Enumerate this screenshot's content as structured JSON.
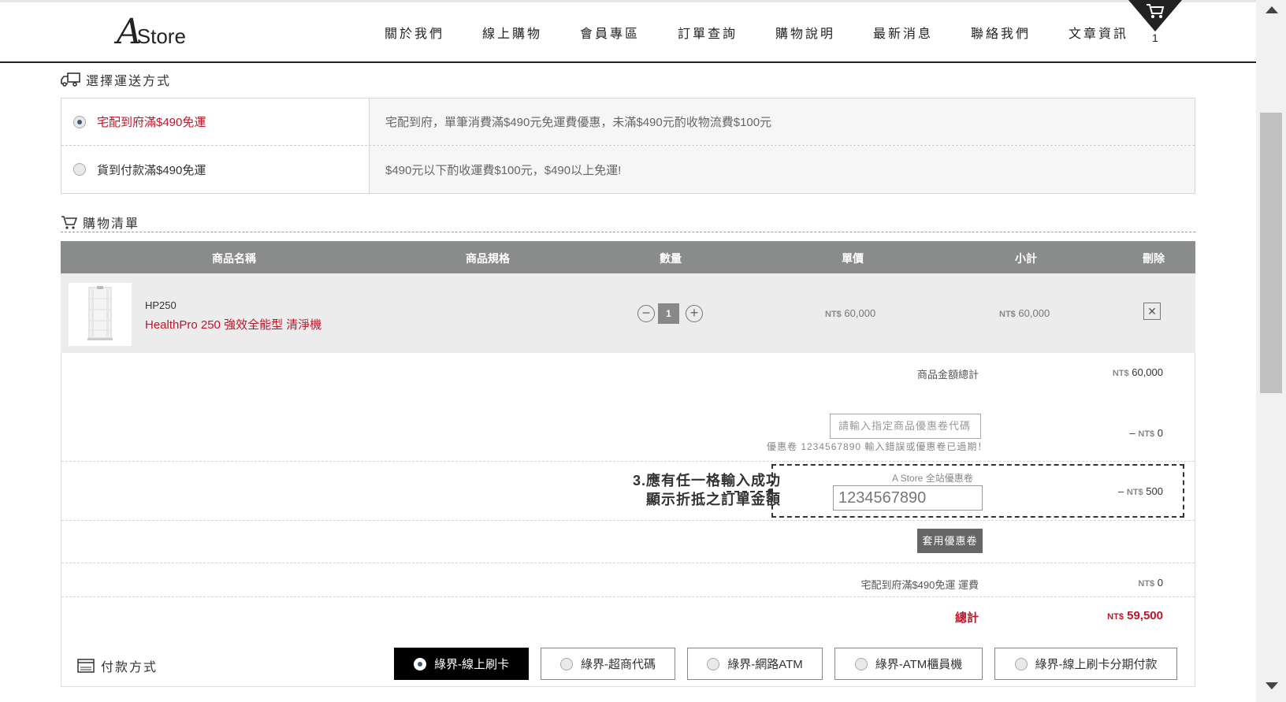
{
  "header": {
    "logo_a": "A",
    "logo_store": "Store",
    "nav": [
      "關於我們",
      "線上購物",
      "會員專區",
      "訂單查詢",
      "購物說明",
      "最新消息",
      "聯絡我們",
      "文章資訊"
    ],
    "cart_count": "1",
    "cart_icon": "cart-icon"
  },
  "shipping": {
    "title": "選擇運送方式",
    "options": [
      {
        "label": "宅配到府滿$490免運",
        "desc": "宅配到府，單筆消費滿$490元免運費優惠，未滿$490元酌收物流費$100元",
        "selected": true
      },
      {
        "label": "貨到付款滿$490免運",
        "desc": "$490元以下酌收運費$100元，$490以上免運!",
        "selected": false
      }
    ]
  },
  "cart": {
    "title": "購物清單",
    "columns": [
      "商品名稱",
      "商品規格",
      "數量",
      "單價",
      "小計",
      "刪除"
    ],
    "items": [
      {
        "sku": "HP250",
        "name": "HealthPro 250 強效全能型 清淨機",
        "qty": "1",
        "unit_price": "60,000",
        "subtotal": "60,000",
        "currency": "NT$"
      }
    ],
    "qty_minus": "−",
    "qty_plus": "+",
    "delete_symbol": "✕"
  },
  "summary": {
    "currency": "NT$",
    "goods_total_label": "商品金額總計",
    "goods_total_value": "60,000",
    "product_coupon_placeholder": "請輸入指定商品優惠卷代碼",
    "product_coupon_error": "優惠卷 1234567890 輸入錯誤或優惠卷已過期！",
    "product_coupon_prefix": "–",
    "product_coupon_value": "0",
    "site_coupon_label": "A Store 全站優惠卷",
    "site_coupon_value_input": "1234567890",
    "site_coupon_prefix": "–",
    "site_coupon_value": "500",
    "annotation_line1": "3.應有任一格輸入成功",
    "annotation_line2": "顯示折抵之訂單金額",
    "apply_button": "套用優惠卷",
    "shipping_label": "宅配到府滿$490免運 運費",
    "shipping_value": "0",
    "total_label": "總計",
    "total_value": "59,500"
  },
  "payment": {
    "title": "付款方式",
    "options": [
      {
        "label": "綠界-線上刷卡",
        "selected": true
      },
      {
        "label": "綠界-超商代碼",
        "selected": false
      },
      {
        "label": "綠界-網路ATM",
        "selected": false
      },
      {
        "label": "綠界-ATM櫃員機",
        "selected": false
      },
      {
        "label": "綠界-線上刷卡分期付款",
        "selected": false
      }
    ]
  },
  "colors": {
    "accent_red": "#c0142b",
    "header_gray": "#8a8b8b",
    "dark": "#222222"
  }
}
